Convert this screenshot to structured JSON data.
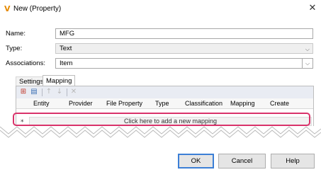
{
  "window": {
    "title": "New (Property)",
    "logo": "V"
  },
  "form": {
    "name_label": "Name:",
    "name_value": "MFG",
    "type_label": "Type:",
    "type_value": "Text",
    "assoc_label": "Associations:",
    "assoc_value": "Item"
  },
  "tabs": [
    {
      "label": "Settings"
    },
    {
      "label": "Mapping"
    }
  ],
  "grid": {
    "columns": [
      "Entity",
      "Provider",
      "File Property",
      "Type",
      "Classification",
      "Mapping",
      "Create"
    ],
    "row_marker": "*",
    "add_row_text": "Click here to add a new mapping"
  },
  "buttons": {
    "ok": "OK",
    "cancel": "Cancel",
    "help": "Help"
  },
  "colors": {
    "highlight": "#d9336b",
    "ok_border": "#3c7fd6",
    "toolbar_bg": "#e9ecf3"
  }
}
